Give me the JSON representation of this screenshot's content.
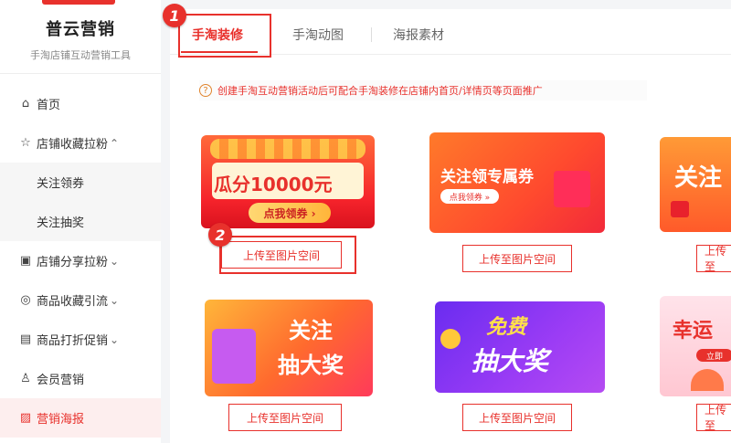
{
  "sidebar": {
    "brand": "普云营销",
    "tagline": "手淘店铺互动营销工具",
    "items": [
      {
        "label": "首页",
        "icon": "home-icon",
        "glyph": "⌂"
      },
      {
        "label": "店铺收藏拉粉",
        "icon": "star-icon",
        "glyph": "☆",
        "chevron": "⌃"
      },
      {
        "label": "关注领券",
        "sub": true
      },
      {
        "label": "关注抽奖",
        "sub": true
      },
      {
        "label": "店铺分享拉粉",
        "icon": "share-icon",
        "glyph": "▣",
        "chevron": "⌄"
      },
      {
        "label": "商品收藏引流",
        "icon": "collect-icon",
        "glyph": "◎",
        "chevron": "⌄"
      },
      {
        "label": "商品打折促销",
        "icon": "discount-icon",
        "glyph": "▤",
        "chevron": "⌄"
      },
      {
        "label": "会员营销",
        "icon": "member-icon",
        "glyph": "♙"
      },
      {
        "label": "营销海报",
        "icon": "poster-icon",
        "glyph": "▨",
        "active": true
      }
    ]
  },
  "tabs": [
    "手淘装修",
    "手淘动图",
    "海报素材"
  ],
  "notice": "创建手淘互动营销活动后可配合手淘装修在店铺内首页/详情页等页面推广",
  "notice_icon": "?",
  "badges": [
    "1",
    "2"
  ],
  "cards": [
    {
      "main_text": "瓜分10000元",
      "sub_text": "点我领券 ›",
      "button": "上传至图片空间"
    },
    {
      "main_text": "关注领专属券",
      "sub_text": "点我领券 »",
      "button": "上传至图片空间"
    },
    {
      "main_text": "关注",
      "sub_text": "",
      "button": "上传至"
    },
    {
      "main_text": "关注",
      "main_text2": "抽大奖",
      "button": "上传至图片空间"
    },
    {
      "main_text": "免费",
      "main_text2": "抽大奖",
      "button": "上传至图片空间"
    },
    {
      "main_text": "幸运",
      "sub_text": "立即",
      "button": "上传至"
    }
  ],
  "colors": {
    "accent": "#e8312c",
    "active_bg": "#fdeeee"
  }
}
